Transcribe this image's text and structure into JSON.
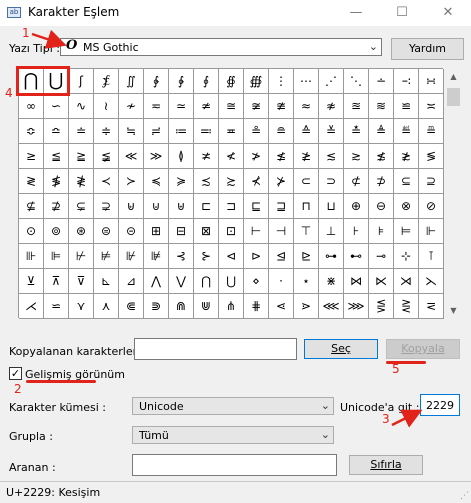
{
  "window": {
    "title": "Karakter Eşlem",
    "icon_text": "ab",
    "minimize_glyph": "—",
    "maximize_glyph": "☐",
    "close_glyph": "✕"
  },
  "font_row": {
    "label": "Yazı Tipi :",
    "font_name": "MS Gothic",
    "font_glyph": "O",
    "help_button": "Yardım"
  },
  "grid_cells": [
    "⋂",
    "⋃",
    "ʃ",
    "⨋",
    "∬",
    "∲",
    "∳",
    "∮",
    "∯",
    "∰",
    "⋮",
    "⋯",
    "⋰",
    "⋱",
    "∸",
    "∹",
    "∺",
    "∞",
    "∽",
    "∿",
    "≀",
    "≁",
    "≂",
    "≃",
    "≄",
    "≅",
    "≆",
    "≇",
    "≈",
    "≉",
    "≊",
    "≋",
    "≌",
    "≍",
    "≎",
    "≏",
    "≐",
    "≑",
    "≒",
    "≓",
    "≔",
    "≕",
    "≖",
    "≗",
    "≘",
    "≙",
    "≚",
    "≛",
    "≜",
    "≝",
    "≞",
    "≥",
    "≦",
    "≧",
    "≨",
    "≪",
    "≫",
    "≬",
    "≭",
    "≮",
    "≯",
    "≰",
    "≱",
    "≲",
    "≳",
    "≴",
    "≵",
    "≶",
    "≷",
    "≸",
    "≹",
    "≺",
    "≻",
    "≼",
    "≽",
    "≾",
    "≿",
    "⊀",
    "⊁",
    "⊂",
    "⊃",
    "⊄",
    "⊅",
    "⊆",
    "⊇",
    "⊈",
    "⊉",
    "⊊",
    "⊋",
    "⊌",
    "⊍",
    "⊎",
    "⊏",
    "⊐",
    "⊑",
    "⊒",
    "⊓",
    "⊔",
    "⊕",
    "⊖",
    "⊗",
    "⊘",
    "⊙",
    "⊚",
    "⊛",
    "⊜",
    "⊝",
    "⊞",
    "⊟",
    "⊠",
    "⊡",
    "⊢",
    "⊣",
    "⊤",
    "⊥",
    "⊦",
    "⊧",
    "⊨",
    "⊩",
    "⊪",
    "⊫",
    "⊬",
    "⊭",
    "⊮",
    "⊯",
    "⊰",
    "⊱",
    "⊲",
    "⊳",
    "⊴",
    "⊵",
    "⊶",
    "⊷",
    "⊸",
    "⊹",
    "⊺",
    "⊻",
    "⊼",
    "⊽",
    "⊾",
    "⊿",
    "⋀",
    "⋁",
    "⋂",
    "⋃",
    "⋄",
    "⋅",
    "⋆",
    "⋇",
    "⋈",
    "⋉",
    "⋊",
    "⋋",
    "⋌",
    "⋍",
    "⋎",
    "⋏",
    "⋐",
    "⋑",
    "⋒",
    "⋓",
    "⋔",
    "⋕",
    "⋖",
    "⋗",
    "⋘",
    "⋙",
    "⋚",
    "⋛",
    "⋜"
  ],
  "copy_row": {
    "label": "Kopyalanan karakterler :",
    "value": "",
    "select_button": "Seç",
    "copy_button": "Kopyala"
  },
  "advanced": {
    "checked_mark": "✓",
    "label": "Gelişmiş görünüm"
  },
  "charset": {
    "label": "Karakter kümesi :",
    "value": "Unicode"
  },
  "goto_unicode": {
    "label": "Unicode'a git :",
    "value": "2229"
  },
  "group_by": {
    "label": "Grupla :",
    "value": "Tümü"
  },
  "search": {
    "label": "Aranan :",
    "value": "",
    "reset_button": "Sıfırla"
  },
  "status_bar": {
    "text": "U+2229: Kesişim"
  },
  "scrollbar": {
    "up_glyph": "▲",
    "down_glyph": "▼"
  },
  "annotations": {
    "n1": "1",
    "n2": "2",
    "n3": "3",
    "n4": "4",
    "n5": "5"
  }
}
